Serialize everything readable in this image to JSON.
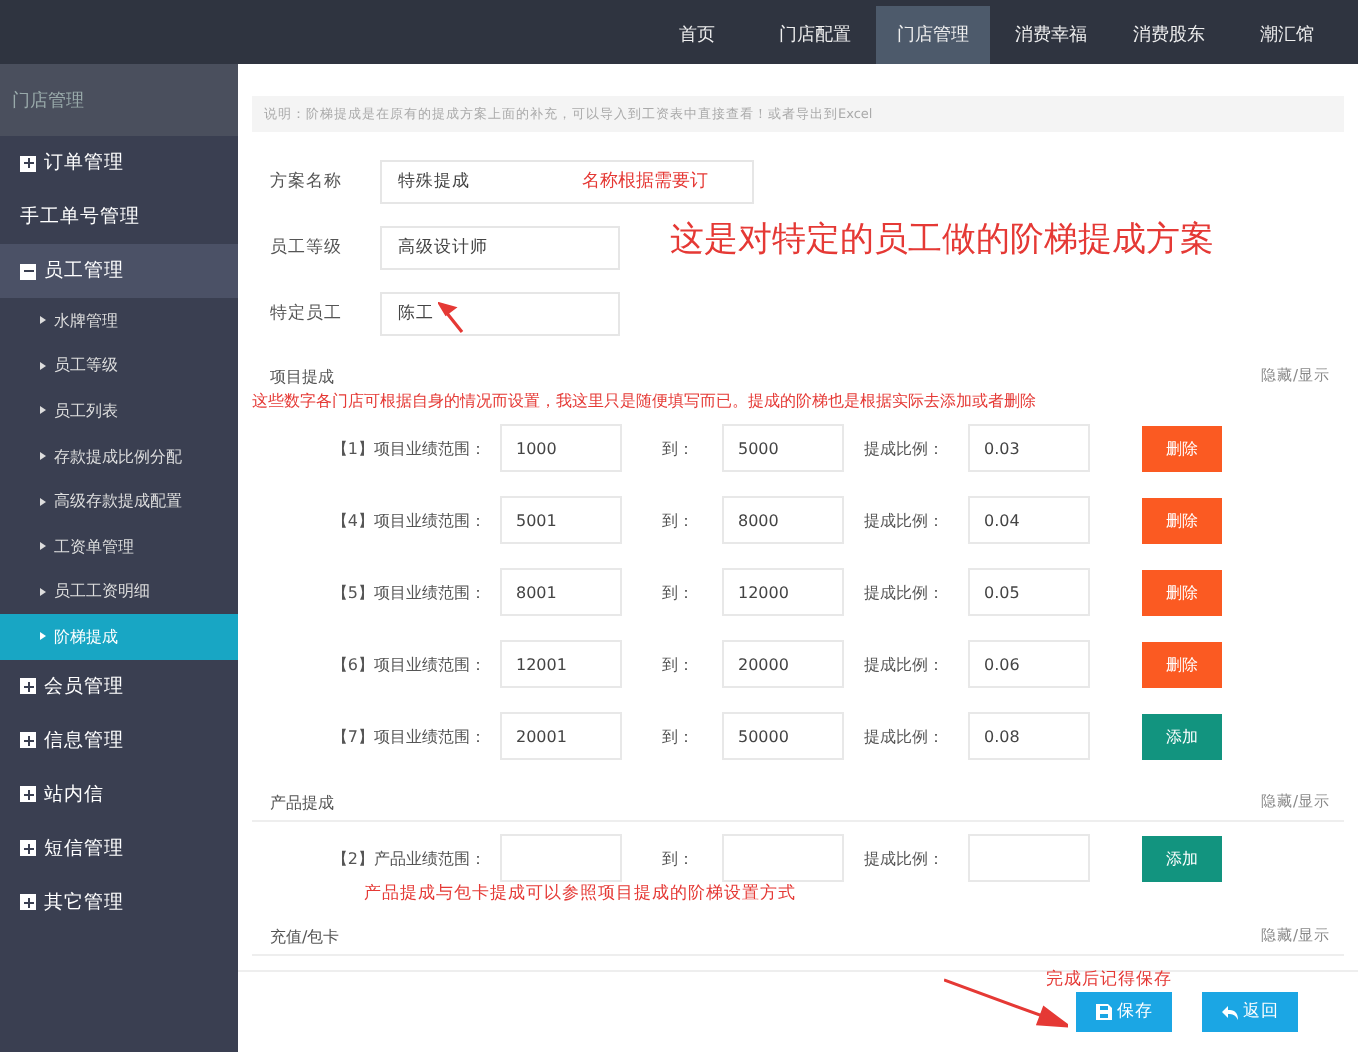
{
  "nav": {
    "items": [
      {
        "label": "首页",
        "selected": false
      },
      {
        "label": "门店配置",
        "selected": false
      },
      {
        "label": "门店管理",
        "selected": true
      },
      {
        "label": "消费幸福",
        "selected": false
      },
      {
        "label": "消费股东",
        "selected": false
      },
      {
        "label": "潮汇馆",
        "selected": false
      }
    ]
  },
  "sidebar": {
    "title": "门店管理",
    "items": [
      {
        "label": "订单管理",
        "kind": "group",
        "expanded": false
      },
      {
        "label": "手工单号管理",
        "kind": "plain"
      },
      {
        "label": "员工管理",
        "kind": "group",
        "expanded": true,
        "children": [
          {
            "label": "水牌管理",
            "selected": false
          },
          {
            "label": "员工等级",
            "selected": false
          },
          {
            "label": "员工列表",
            "selected": false
          },
          {
            "label": "存款提成比例分配",
            "selected": false
          },
          {
            "label": "高级存款提成配置",
            "selected": false
          },
          {
            "label": "工资单管理",
            "selected": false
          },
          {
            "label": "员工工资明细",
            "selected": false
          },
          {
            "label": "阶梯提成",
            "selected": true
          }
        ]
      },
      {
        "label": "会员管理",
        "kind": "group",
        "expanded": false
      },
      {
        "label": "信息管理",
        "kind": "group",
        "expanded": false
      },
      {
        "label": "站内信",
        "kind": "group",
        "expanded": false
      },
      {
        "label": "短信管理",
        "kind": "group",
        "expanded": false
      },
      {
        "label": "其它管理",
        "kind": "group",
        "expanded": false
      }
    ]
  },
  "notice": "说明：阶梯提成是在原有的提成方案上面的补充，可以导入到工资表中直接查看！或者导出到Excel",
  "form": {
    "note": "这是对特定的员工做的阶梯提成方案",
    "fields": [
      {
        "label": "方案名称",
        "value": "特殊提成",
        "note": "名称根据需要订"
      },
      {
        "label": "员工等级",
        "value": "高级设计师"
      },
      {
        "label": "特定员工",
        "value": "陈工"
      }
    ]
  },
  "sections": [
    {
      "title": "项目提成",
      "toggle": "隐藏/显示",
      "note": "这些数字各门店可根据自身的情况而设置，我这里只是随便填写而已。提成的阶梯也是根据实际去添加或者删除",
      "rows": [
        {
          "label": "【1】项目业绩范围：",
          "from": "1000",
          "to_label": "到：",
          "to": "5000",
          "ratio_label": "提成比例：",
          "ratio": "0.03",
          "button": {
            "kind": "delete",
            "label": "删除"
          }
        },
        {
          "label": "【4】项目业绩范围：",
          "from": "5001",
          "to_label": "到：",
          "to": "8000",
          "ratio_label": "提成比例：",
          "ratio": "0.04",
          "button": {
            "kind": "delete",
            "label": "删除"
          }
        },
        {
          "label": "【5】项目业绩范围：",
          "from": "8001",
          "to_label": "到：",
          "to": "12000",
          "ratio_label": "提成比例：",
          "ratio": "0.05",
          "button": {
            "kind": "delete",
            "label": "删除"
          }
        },
        {
          "label": "【6】项目业绩范围：",
          "from": "12001",
          "to_label": "到：",
          "to": "20000",
          "ratio_label": "提成比例：",
          "ratio": "0.06",
          "button": {
            "kind": "delete",
            "label": "删除"
          }
        },
        {
          "label": "【7】项目业绩范围：",
          "from": "20001",
          "to_label": "到：",
          "to": "50000",
          "ratio_label": "提成比例：",
          "ratio": "0.08",
          "button": {
            "kind": "add",
            "label": "添加"
          }
        }
      ]
    },
    {
      "title": "产品提成",
      "toggle": "隐藏/显示",
      "note_after": "产品提成与包卡提成可以参照项目提成的阶梯设置方式",
      "rows": [
        {
          "label": "【2】产品业绩范围：",
          "to_label": "到：",
          "ratio_label": "提成比例：",
          "button": {
            "kind": "add",
            "label": "添加"
          }
        }
      ]
    },
    {
      "title": "充值/包卡",
      "toggle": "隐藏/显示"
    }
  ],
  "footer": {
    "note": "完成后记得保存",
    "buttons": [
      {
        "kind": "save",
        "label": "保存"
      },
      {
        "kind": "back",
        "label": "返回"
      }
    ]
  }
}
